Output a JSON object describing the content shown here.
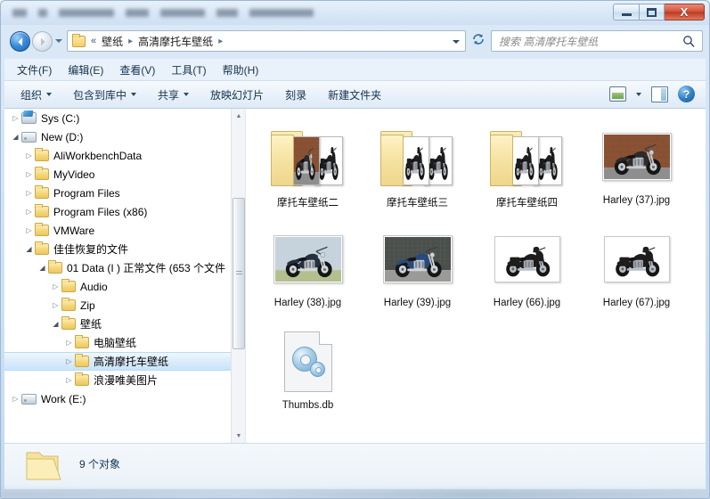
{
  "window": {
    "title_obscured": true,
    "controls": {
      "minimize": "–",
      "maximize": "□",
      "close": "X"
    }
  },
  "navigation": {
    "back_icon": "back-arrow",
    "forward_icon": "forward-arrow",
    "recent_dropdown_icon": "chevron-down-icon",
    "breadcrumb": {
      "overflow_chevron": "«",
      "separator": "▸",
      "items": [
        "壁纸",
        "高清摩托车壁纸"
      ]
    },
    "refresh_icon": "↻",
    "address_dropdown_icon": "chevron-down-icon"
  },
  "search": {
    "placeholder": "搜索 高清摩托车壁纸",
    "value": "",
    "icon": "search-icon"
  },
  "menubar": {
    "items": [
      {
        "text": "文件(F)",
        "accel": "F"
      },
      {
        "text": "编辑(E)",
        "accel": "E"
      },
      {
        "text": "查看(V)",
        "accel": "V"
      },
      {
        "text": "工具(T)",
        "accel": "T"
      },
      {
        "text": "帮助(H)",
        "accel": "H"
      }
    ]
  },
  "toolbar": {
    "items": [
      {
        "label": "组织",
        "has_caret": true
      },
      {
        "label": "包含到库中",
        "has_caret": true
      },
      {
        "label": "共享",
        "has_caret": true
      },
      {
        "label": "放映幻灯片",
        "has_caret": false
      },
      {
        "label": "刻录",
        "has_caret": false
      },
      {
        "label": "新建文件夹",
        "has_caret": false
      }
    ],
    "right_icons": [
      {
        "name": "view-mode-icon"
      },
      {
        "name": "view-mode-caret-icon"
      },
      {
        "name": "preview-pane-icon"
      },
      {
        "name": "help-icon",
        "glyph": "?"
      }
    ]
  },
  "sidebar": {
    "items": [
      {
        "label": "Sys (C:)",
        "indent": 0,
        "icon": "system-drive-icon",
        "twisty": "collapsed",
        "selected": false
      },
      {
        "label": "New (D:)",
        "indent": 0,
        "icon": "drive-icon",
        "twisty": "expanded",
        "selected": false
      },
      {
        "label": "AliWorkbenchData",
        "indent": 1,
        "icon": "folder-icon",
        "twisty": "collapsed",
        "selected": false
      },
      {
        "label": "MyVideo",
        "indent": 1,
        "icon": "folder-icon",
        "twisty": "collapsed",
        "selected": false
      },
      {
        "label": "Program Files",
        "indent": 1,
        "icon": "folder-icon",
        "twisty": "collapsed",
        "selected": false
      },
      {
        "label": "Program Files (x86)",
        "indent": 1,
        "icon": "folder-icon",
        "twisty": "collapsed",
        "selected": false
      },
      {
        "label": "VMWare",
        "indent": 1,
        "icon": "folder-icon",
        "twisty": "collapsed",
        "selected": false
      },
      {
        "label": "佳佳恢复的文件",
        "indent": 1,
        "icon": "folder-icon",
        "twisty": "expanded",
        "selected": false
      },
      {
        "label": "01 Data (I ) 正常文件 (653 个文件",
        "indent": 2,
        "icon": "folder-icon",
        "twisty": "expanded",
        "selected": false
      },
      {
        "label": "Audio",
        "indent": 3,
        "icon": "folder-icon",
        "twisty": "collapsed",
        "selected": false
      },
      {
        "label": "Zip",
        "indent": 3,
        "icon": "folder-icon",
        "twisty": "collapsed",
        "selected": false
      },
      {
        "label": "壁纸",
        "indent": 3,
        "icon": "folder-icon",
        "twisty": "expanded",
        "selected": false
      },
      {
        "label": "电脑壁纸",
        "indent": 4,
        "icon": "folder-icon",
        "twisty": "collapsed",
        "selected": false
      },
      {
        "label": "高清摩托车壁纸",
        "indent": 4,
        "icon": "folder-icon",
        "twisty": "collapsed",
        "selected": true
      },
      {
        "label": "浪漫唯美图片",
        "indent": 4,
        "icon": "folder-icon",
        "twisty": "collapsed",
        "selected": false
      },
      {
        "label": "Work (E:)",
        "indent": 0,
        "icon": "drive-icon",
        "twisty": "collapsed",
        "selected": false
      }
    ],
    "scrollbar": {
      "up_arrow": "▲",
      "down_arrow": "▼"
    }
  },
  "files": {
    "items": [
      {
        "name": "摩托车壁纸二",
        "type": "folder",
        "thumb": "folder-with-photos"
      },
      {
        "name": "摩托车壁纸三",
        "type": "folder",
        "thumb": "folder-with-photos"
      },
      {
        "name": "摩托车壁纸四",
        "type": "folder",
        "thumb": "folder-with-photos"
      },
      {
        "name": "Harley (37).jpg",
        "type": "image",
        "thumb": "motorcycle-brick-wall"
      },
      {
        "name": "Harley (38).jpg",
        "type": "image",
        "thumb": "motorcycle-field"
      },
      {
        "name": "Harley (39).jpg",
        "type": "image",
        "thumb": "motorcycle-blue-street"
      },
      {
        "name": "Harley (66).jpg",
        "type": "image",
        "thumb": "motorcycle-white-bg"
      },
      {
        "name": "Harley (67).jpg",
        "type": "image",
        "thumb": "motorcycle-white-bg"
      },
      {
        "name": "Thumbs.db",
        "type": "file",
        "thumb": "generic-gear-file"
      }
    ]
  },
  "statusbar": {
    "icon": "open-folder-icon",
    "text": "9 个对象"
  },
  "colors": {
    "accent": "#2f7fc4",
    "selection": "#cbe4f9",
    "close_button": "#bb3b21",
    "folder_yellow": "#f4d679",
    "frame": "#cfe0f3"
  }
}
